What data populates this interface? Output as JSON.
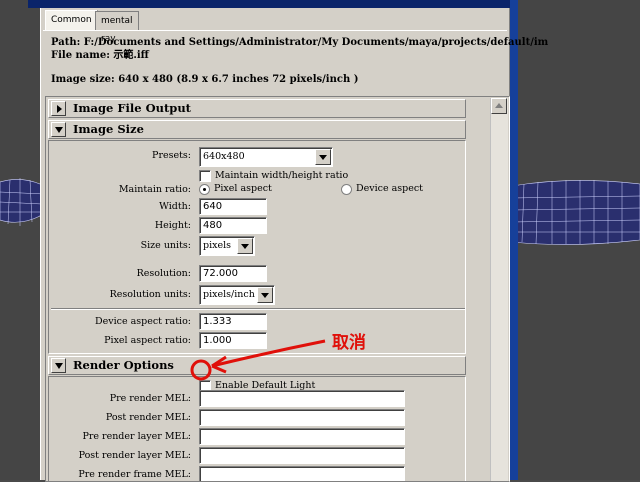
{
  "tabs": [
    {
      "label": "Common",
      "active": true
    },
    {
      "label": "mental ray",
      "active": false
    }
  ],
  "info": {
    "path": "Path: F:/Documents and Settings/Administrator/My Documents/maya/projects/default/im",
    "file_name": "File name:  示範.iff",
    "image_size": "Image size: 640 x 480 (8.9 x 6.7 inches 72 pixels/inch )"
  },
  "sections": {
    "image_file_output": {
      "title": "Image File Output",
      "expanded": false
    },
    "image_size": {
      "title": "Image Size",
      "expanded": true,
      "presets_label": "Presets:",
      "presets_value": "640x480",
      "maintain_wh_label": "Maintain width/height ratio",
      "maintain_wh_checked": false,
      "maintain_ratio_label": "Maintain ratio:",
      "pixel_aspect_label": "Pixel aspect",
      "device_aspect_label": "Device aspect",
      "selected_ratio": "Pixel aspect",
      "width_label": "Width:",
      "width_value": "640",
      "height_label": "Height:",
      "height_value": "480",
      "size_units_label": "Size units:",
      "size_units_value": "pixels",
      "resolution_label": "Resolution:",
      "resolution_value": "72.000",
      "resolution_units_label": "Resolution units:",
      "resolution_units_value": "pixels/inch",
      "device_aspect_ratio_label": "Device aspect ratio:",
      "device_aspect_ratio_value": "1.333",
      "pixel_aspect_ratio_label": "Pixel aspect ratio:",
      "pixel_aspect_ratio_value": "1.000"
    },
    "render_options": {
      "title": "Render Options",
      "expanded": true,
      "enable_default_light_label": "Enable Default Light",
      "enable_default_light_checked": false,
      "fields": [
        {
          "label": "Pre render MEL:",
          "value": ""
        },
        {
          "label": "Post render MEL:",
          "value": ""
        },
        {
          "label": "Pre render layer MEL:",
          "value": ""
        },
        {
          "label": "Post render layer MEL:",
          "value": ""
        },
        {
          "label": "Pre render frame MEL:",
          "value": ""
        }
      ]
    }
  },
  "annotation": {
    "text": "取消",
    "color": "#e0100a"
  }
}
